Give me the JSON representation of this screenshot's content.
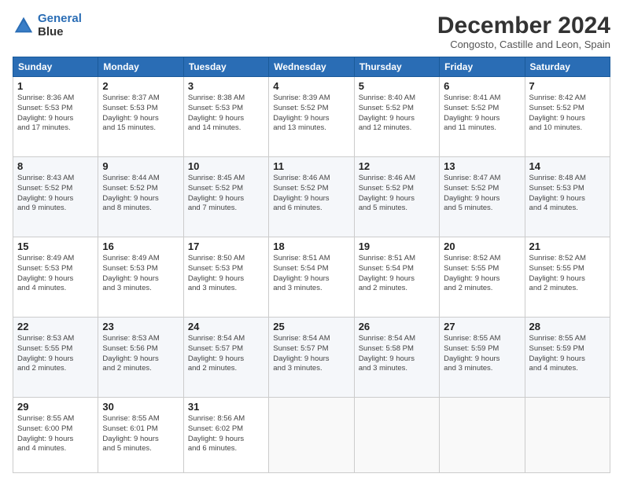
{
  "header": {
    "logo_line1": "General",
    "logo_line2": "Blue",
    "month_title": "December 2024",
    "location": "Congosto, Castille and Leon, Spain"
  },
  "weekdays": [
    "Sunday",
    "Monday",
    "Tuesday",
    "Wednesday",
    "Thursday",
    "Friday",
    "Saturday"
  ],
  "weeks": [
    [
      {
        "day": "1",
        "info": "Sunrise: 8:36 AM\nSunset: 5:53 PM\nDaylight: 9 hours\nand 17 minutes."
      },
      {
        "day": "2",
        "info": "Sunrise: 8:37 AM\nSunset: 5:53 PM\nDaylight: 9 hours\nand 15 minutes."
      },
      {
        "day": "3",
        "info": "Sunrise: 8:38 AM\nSunset: 5:53 PM\nDaylight: 9 hours\nand 14 minutes."
      },
      {
        "day": "4",
        "info": "Sunrise: 8:39 AM\nSunset: 5:52 PM\nDaylight: 9 hours\nand 13 minutes."
      },
      {
        "day": "5",
        "info": "Sunrise: 8:40 AM\nSunset: 5:52 PM\nDaylight: 9 hours\nand 12 minutes."
      },
      {
        "day": "6",
        "info": "Sunrise: 8:41 AM\nSunset: 5:52 PM\nDaylight: 9 hours\nand 11 minutes."
      },
      {
        "day": "7",
        "info": "Sunrise: 8:42 AM\nSunset: 5:52 PM\nDaylight: 9 hours\nand 10 minutes."
      }
    ],
    [
      {
        "day": "8",
        "info": "Sunrise: 8:43 AM\nSunset: 5:52 PM\nDaylight: 9 hours\nand 9 minutes."
      },
      {
        "day": "9",
        "info": "Sunrise: 8:44 AM\nSunset: 5:52 PM\nDaylight: 9 hours\nand 8 minutes."
      },
      {
        "day": "10",
        "info": "Sunrise: 8:45 AM\nSunset: 5:52 PM\nDaylight: 9 hours\nand 7 minutes."
      },
      {
        "day": "11",
        "info": "Sunrise: 8:46 AM\nSunset: 5:52 PM\nDaylight: 9 hours\nand 6 minutes."
      },
      {
        "day": "12",
        "info": "Sunrise: 8:46 AM\nSunset: 5:52 PM\nDaylight: 9 hours\nand 5 minutes."
      },
      {
        "day": "13",
        "info": "Sunrise: 8:47 AM\nSunset: 5:52 PM\nDaylight: 9 hours\nand 5 minutes."
      },
      {
        "day": "14",
        "info": "Sunrise: 8:48 AM\nSunset: 5:53 PM\nDaylight: 9 hours\nand 4 minutes."
      }
    ],
    [
      {
        "day": "15",
        "info": "Sunrise: 8:49 AM\nSunset: 5:53 PM\nDaylight: 9 hours\nand 4 minutes."
      },
      {
        "day": "16",
        "info": "Sunrise: 8:49 AM\nSunset: 5:53 PM\nDaylight: 9 hours\nand 3 minutes."
      },
      {
        "day": "17",
        "info": "Sunrise: 8:50 AM\nSunset: 5:53 PM\nDaylight: 9 hours\nand 3 minutes."
      },
      {
        "day": "18",
        "info": "Sunrise: 8:51 AM\nSunset: 5:54 PM\nDaylight: 9 hours\nand 3 minutes."
      },
      {
        "day": "19",
        "info": "Sunrise: 8:51 AM\nSunset: 5:54 PM\nDaylight: 9 hours\nand 2 minutes."
      },
      {
        "day": "20",
        "info": "Sunrise: 8:52 AM\nSunset: 5:55 PM\nDaylight: 9 hours\nand 2 minutes."
      },
      {
        "day": "21",
        "info": "Sunrise: 8:52 AM\nSunset: 5:55 PM\nDaylight: 9 hours\nand 2 minutes."
      }
    ],
    [
      {
        "day": "22",
        "info": "Sunrise: 8:53 AM\nSunset: 5:55 PM\nDaylight: 9 hours\nand 2 minutes."
      },
      {
        "day": "23",
        "info": "Sunrise: 8:53 AM\nSunset: 5:56 PM\nDaylight: 9 hours\nand 2 minutes."
      },
      {
        "day": "24",
        "info": "Sunrise: 8:54 AM\nSunset: 5:57 PM\nDaylight: 9 hours\nand 2 minutes."
      },
      {
        "day": "25",
        "info": "Sunrise: 8:54 AM\nSunset: 5:57 PM\nDaylight: 9 hours\nand 3 minutes."
      },
      {
        "day": "26",
        "info": "Sunrise: 8:54 AM\nSunset: 5:58 PM\nDaylight: 9 hours\nand 3 minutes."
      },
      {
        "day": "27",
        "info": "Sunrise: 8:55 AM\nSunset: 5:59 PM\nDaylight: 9 hours\nand 3 minutes."
      },
      {
        "day": "28",
        "info": "Sunrise: 8:55 AM\nSunset: 5:59 PM\nDaylight: 9 hours\nand 4 minutes."
      }
    ],
    [
      {
        "day": "29",
        "info": "Sunrise: 8:55 AM\nSunset: 6:00 PM\nDaylight: 9 hours\nand 4 minutes."
      },
      {
        "day": "30",
        "info": "Sunrise: 8:55 AM\nSunset: 6:01 PM\nDaylight: 9 hours\nand 5 minutes."
      },
      {
        "day": "31",
        "info": "Sunrise: 8:56 AM\nSunset: 6:02 PM\nDaylight: 9 hours\nand 6 minutes."
      },
      null,
      null,
      null,
      null
    ]
  ]
}
